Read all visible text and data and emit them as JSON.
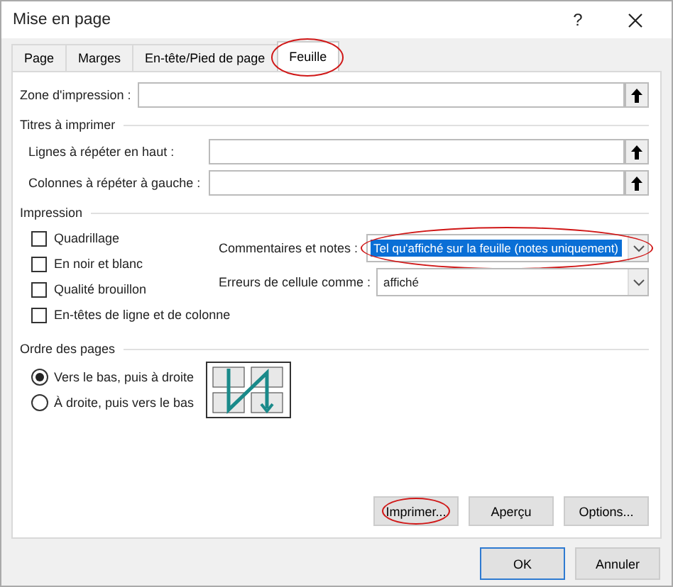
{
  "window": {
    "title": "Mise en page",
    "help": "?"
  },
  "tabs": [
    {
      "label": "Page",
      "selected": false,
      "circled": false
    },
    {
      "label": "Marges",
      "selected": false,
      "circled": false
    },
    {
      "label": "En-tête/Pied de page",
      "selected": false,
      "circled": false
    },
    {
      "label": "Feuille",
      "selected": true,
      "circled": true
    }
  ],
  "print_area": {
    "label": "Zone d'impression :"
  },
  "print_titles": {
    "heading": "Titres à imprimer",
    "fields": [
      {
        "label": "Lignes à répéter en haut :"
      },
      {
        "label": "Colonnes à répéter à gauche :"
      }
    ]
  },
  "printing": {
    "heading": "Impression",
    "checkboxes": [
      {
        "label": "Quadrillage",
        "checked": false
      },
      {
        "label": "En noir et blanc",
        "checked": false
      },
      {
        "label": "Qualité brouillon",
        "checked": false
      },
      {
        "label": "En-têtes de ligne et de colonne",
        "checked": false
      }
    ],
    "dropdowns": [
      {
        "label": "Commentaires et notes :",
        "value": "Tel qu'affiché sur la feuille (notes uniquement)",
        "highlighted": true,
        "circled": true
      },
      {
        "label": "Erreurs de cellule comme :",
        "value": "affiché",
        "highlighted": false,
        "circled": false
      }
    ]
  },
  "page_order": {
    "heading": "Ordre des pages",
    "options": [
      {
        "label": "Vers le bas, puis à droite",
        "selected": true
      },
      {
        "label": "À droite, puis vers le bas",
        "selected": false
      }
    ]
  },
  "buttons": [
    {
      "label": "Imprimer...",
      "circled": true
    },
    {
      "label": "Aperçu",
      "circled": false
    },
    {
      "label": "Options...",
      "circled": false
    }
  ],
  "footer_buttons": [
    {
      "label": "OK",
      "default": true
    },
    {
      "label": "Annuler",
      "default": false
    }
  ]
}
